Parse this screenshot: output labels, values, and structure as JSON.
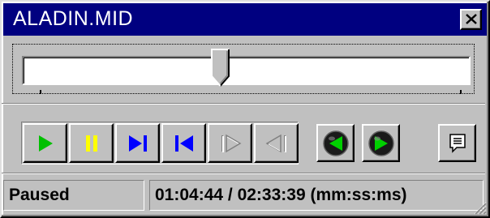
{
  "window": {
    "title": "ALADIN.MID"
  },
  "seek": {
    "position_fraction": 0.44
  },
  "transport": {
    "buttons": [
      {
        "name": "play-button",
        "icon": "play-icon",
        "enabled": true
      },
      {
        "name": "pause-button",
        "icon": "pause-icon",
        "enabled": true
      },
      {
        "name": "next-track-button",
        "icon": "skip-next-icon",
        "enabled": true
      },
      {
        "name": "previous-track-button",
        "icon": "skip-previous-icon",
        "enabled": true
      },
      {
        "name": "step-forward-button",
        "icon": "step-forward-icon",
        "enabled": false
      },
      {
        "name": "step-back-button",
        "icon": "step-back-icon",
        "enabled": false
      }
    ],
    "colors": {
      "play": "#00c000",
      "pause": "#ffff00",
      "skip": "#0000ff",
      "disabled": "#808080"
    }
  },
  "extra_buttons": [
    {
      "name": "rewind-sphere-button",
      "icon": "rewind-globe-icon"
    },
    {
      "name": "forward-sphere-button",
      "icon": "forward-globe-icon"
    },
    {
      "name": "info-button",
      "icon": "speech-bubble-icon"
    }
  ],
  "status": {
    "state": "Paused",
    "time": "01:04:44 / 02:33:39 (mm:ss:ms)"
  }
}
